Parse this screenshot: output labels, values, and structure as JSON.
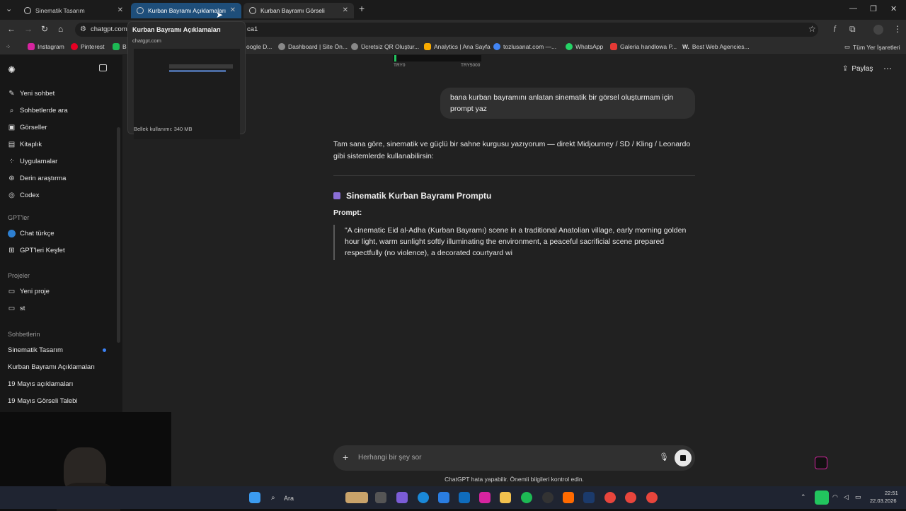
{
  "tabs": [
    {
      "title": "Sinematik Tasarım"
    },
    {
      "title": "Kurban Bayramı Açıklamaları"
    },
    {
      "title": "Kurban Bayramı Görseli"
    }
  ],
  "address": {
    "url_left": "chatgpt.com",
    "url_right": "ca1"
  },
  "bookmarks": [
    {
      "label": "Instagram",
      "color": "#d6249f"
    },
    {
      "label": "Pinterest",
      "color": "#e60023"
    },
    {
      "label": "B",
      "color": "#1db954"
    },
    {
      "label": "oogle D...",
      "color": "#888888"
    },
    {
      "label": "Dashboard | Site Ön...",
      "color": "#888888"
    },
    {
      "label": "Ücretsiz QR Oluştur...",
      "color": "#888888"
    },
    {
      "label": "Analytics | Ana Sayfa",
      "color": "#f9ab00"
    },
    {
      "label": "tozlusanat.com —...",
      "color": "#4285f4"
    },
    {
      "label": "WhatsApp",
      "color": "#25d366"
    },
    {
      "label": "Galeria handlowa P...",
      "color": "#e53935"
    },
    {
      "label": "Best Web Agencies...",
      "color": "#ffffff"
    },
    {
      "label": "Tüm Yer İşaretleri",
      "color": "#cfcfcf"
    }
  ],
  "preview": {
    "title": "Kurban Bayramı Açıklamaları",
    "domain": "chatgpt.com",
    "memory": "Bellek kullanımı: 340 MB"
  },
  "topstrip": {
    "left": "TRY0",
    "right": "TRY5000"
  },
  "sidebar": {
    "items": [
      {
        "label": "Yeni sohbet",
        "icon": "✎"
      },
      {
        "label": "Sohbetlerde ara",
        "icon": "⌕"
      },
      {
        "label": "Görseller",
        "icon": "▣"
      },
      {
        "label": "Kitaplık",
        "icon": "▤"
      },
      {
        "label": "Uygulamalar",
        "icon": "⁘"
      },
      {
        "label": "Derin araştırma",
        "icon": "⊛"
      },
      {
        "label": "Codex",
        "icon": "◎"
      }
    ],
    "gpts_heading": "GPT'ler",
    "gpts": [
      {
        "label": "Chat türkçe"
      },
      {
        "label": "GPT'leri Keşfet"
      }
    ],
    "projects_heading": "Projeler",
    "projects": [
      {
        "label": "Yeni proje"
      },
      {
        "label": "st"
      }
    ],
    "chats_heading": "Sohbetlerin",
    "chats": [
      {
        "label": "Sinematik Tasarım"
      },
      {
        "label": "Kurban Bayramı Açıklamaları"
      },
      {
        "label": "19 Mayıs açıklamaları"
      },
      {
        "label": "19 Mayıs Görseli Talebi"
      }
    ]
  },
  "header": {
    "share_label": "Paylaş"
  },
  "conversation": {
    "user_message": "bana kurban bayramını anlatan sinematik bir görsel oluşturmam için prompt yaz",
    "intro": "Tam sana göre, sinematik ve güçlü bir sahne kurgusu yazıyorum — direkt Midjourney / SD / Kling / Leonardo gibi sistemlerde kullanabilirsin:",
    "section_title": "Sinematik Kurban Bayramı Promptu",
    "prompt_label": "Prompt:",
    "prompt_text": "\"A cinematic Eid al-Adha (Kurban Bayramı) scene in a traditional Anatolian village, early morning golden hour light, warm sunlight softly illuminating the environment, a peaceful sacrificial scene prepared respectfully (no violence), a decorated courtyard wi"
  },
  "composer": {
    "placeholder": "Herhangi bir şey sor"
  },
  "disclaimer": "ChatGPT hata yapabilir. Önemli bilgileri kontrol edin.",
  "taskbar": {
    "search_label": "Ara",
    "time": "22:51",
    "date": "22.03.2026"
  }
}
